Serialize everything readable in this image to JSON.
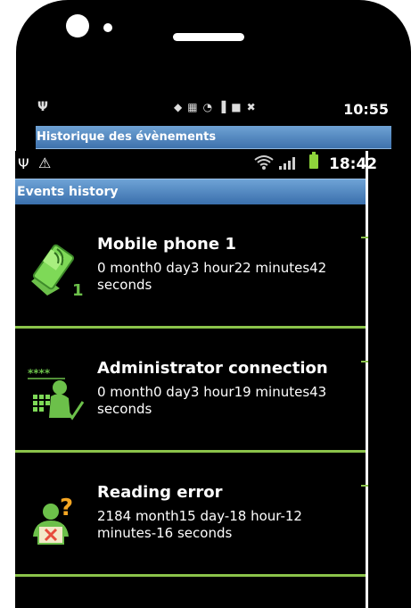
{
  "background_screen": {
    "time": "10:55",
    "title": "Historique des évènements"
  },
  "status_bar": {
    "time": "18:42",
    "icons": [
      "usb-icon",
      "warning-icon",
      "wifi-icon",
      "signal-icon",
      "battery-icon"
    ]
  },
  "header": {
    "title": "Events history",
    "color": "#4a7fbf"
  },
  "events": [
    {
      "name": "Mobile phone 1",
      "description": "0 month0 day3 hour22 minutes42 seconds",
      "icon": "mobile-phone-icon"
    },
    {
      "name": "Administrator connection",
      "description": "0 month0 day3 hour19 minutes43 seconds",
      "icon": "administrator-keypad-icon"
    },
    {
      "name": "Reading error",
      "description": "2184 month15 day-18 hour-12 minutes-16 seconds",
      "icon": "reading-error-icon"
    }
  ],
  "accent": "#8bc34a"
}
